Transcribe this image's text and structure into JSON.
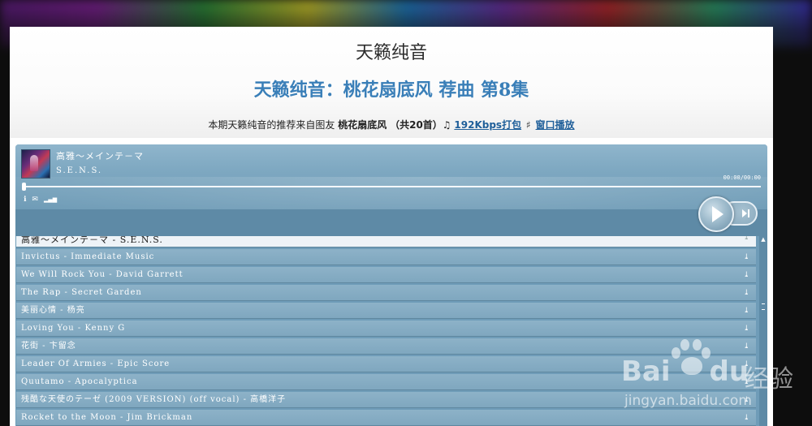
{
  "header": {
    "site_title": "天籁纯音",
    "episode_title": "天籁纯音：桃花扇底风 荐曲 第8集",
    "recommend_prefix": "本期天籁纯音的推荐来自图友",
    "recommender": "桃花扇底风",
    "track_count": "（共20首）♫",
    "download_link": "192Kbps打包",
    "popup_sep": "♯",
    "popup_link": "窗口播放"
  },
  "player": {
    "now_playing_title": "高雅～メインテ－マ",
    "now_playing_artist": "S.E.N.S.",
    "time": "00:00/00:00",
    "progress": 0,
    "icons": [
      "info-icon",
      "mail-icon",
      "signal-icon"
    ],
    "info_glyph": "ℹ",
    "mail_glyph": "✉",
    "signal_glyph": "▂▄▆"
  },
  "playlist": {
    "download_glyph": "⤓",
    "active_index": 0,
    "items": [
      "高雅～メインテ－マ - S.E.N.S.",
      "Invictus - Immediate Music",
      "We Will Rock You - David Garrett",
      "The Rap - Secret Garden",
      "美丽心情 - 杨亮",
      "Loving You - Kenny G",
      "花街 - 卞留念",
      "Leader Of Armies - Epic Score",
      "Quutamo - Apocalyptica",
      "残酷な天使のテーゼ (2009 VERSION) (off vocal) - 高橋洋子",
      "Rocket to the Moon - Jim Brickman"
    ]
  },
  "scrollbar": {
    "up_glyph": "▲"
  },
  "watermark": {
    "brand": "Bai",
    "brand2": "du",
    "cn": "经验",
    "url": "jingyan.baidu.com"
  },
  "colors": {
    "title_blue": "#3a7fb8",
    "link_blue": "#1f5f9a",
    "player_bg": "#6f9cb8",
    "row_bg": "#8db2c8"
  }
}
